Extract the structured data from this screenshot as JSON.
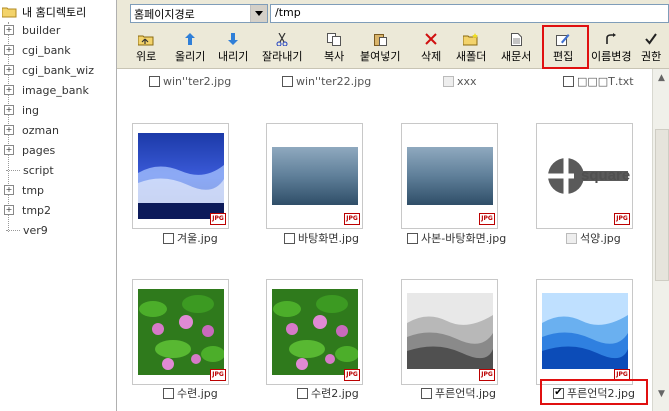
{
  "tree": {
    "root_label": "내 홈디렉토리",
    "items": [
      {
        "label": "builder",
        "expandable": true
      },
      {
        "label": "cgi_bank",
        "expandable": true
      },
      {
        "label": "cgi_bank_wiz",
        "expandable": true
      },
      {
        "label": "image_bank",
        "expandable": true
      },
      {
        "label": "ing",
        "expandable": true
      },
      {
        "label": "ozman",
        "expandable": true
      },
      {
        "label": "pages",
        "expandable": true
      },
      {
        "label": "script",
        "expandable": false
      },
      {
        "label": "tmp",
        "expandable": true
      },
      {
        "label": "tmp2",
        "expandable": true
      },
      {
        "label": "ver9",
        "expandable": false
      }
    ]
  },
  "address": {
    "combo_value": "홈페이지경로",
    "path_value": "/tmp"
  },
  "toolbar": {
    "up": "위로",
    "raise": "올리기",
    "download": "내리기",
    "cut": "잘라내기",
    "copy": "복사",
    "paste": "붙여넣기",
    "delete": "삭제",
    "new_folder": "새폴더",
    "new_doc": "새문서",
    "edit": "편집",
    "rename": "이름변경",
    "permission": "권한"
  },
  "grid": {
    "top_row": [
      {
        "name": "win''ter2.jpg",
        "checked": false,
        "disabled": false
      },
      {
        "name": "win''ter22.jpg",
        "checked": false,
        "disabled": false
      },
      {
        "name": "xxx",
        "checked": false,
        "disabled": true
      },
      {
        "name": "□□□Т.txt",
        "checked": false,
        "disabled": false
      }
    ],
    "row2": [
      {
        "name": "겨울.jpg",
        "checked": false,
        "disabled": false,
        "tag": "JPG"
      },
      {
        "name": "바탕화면.jpg",
        "checked": false,
        "disabled": false,
        "tag": "JPG"
      },
      {
        "name": "사본-바탕화면.jpg",
        "checked": false,
        "disabled": false,
        "tag": "JPG"
      },
      {
        "name": "석양.jpg",
        "checked": false,
        "disabled": true,
        "tag": "JPG"
      }
    ],
    "row3": [
      {
        "name": "수련.jpg",
        "checked": false,
        "disabled": false,
        "tag": "JPG"
      },
      {
        "name": "수련2.jpg",
        "checked": false,
        "disabled": false,
        "tag": "JPG"
      },
      {
        "name": "푸른언덕.jpg",
        "checked": false,
        "disabled": false,
        "tag": "JPG"
      },
      {
        "name": "푸른언덕2.jpg",
        "checked": true,
        "disabled": false,
        "tag": "JPG"
      }
    ],
    "logo_text": "square"
  },
  "colors": {
    "highlight": "#e01010",
    "toolbar_bg": "#ece9d8"
  }
}
